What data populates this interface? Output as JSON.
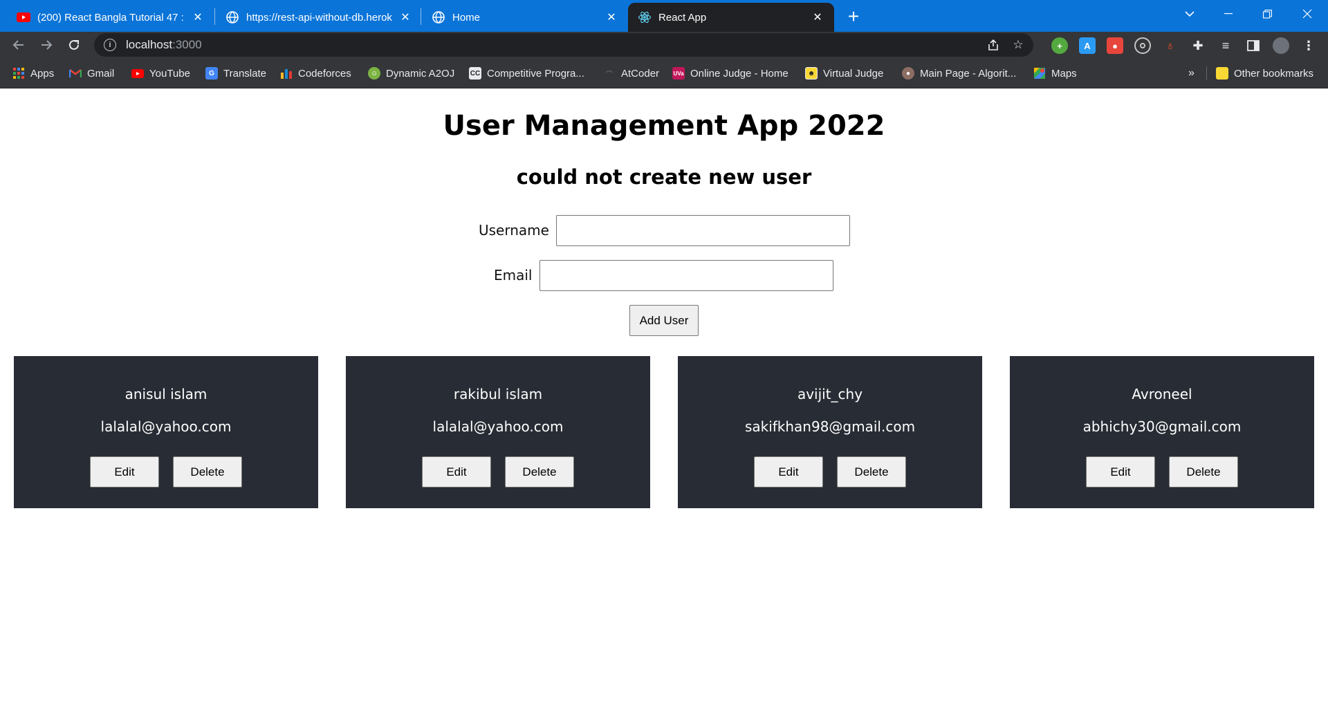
{
  "browser": {
    "tabs": [
      {
        "title": "(200) React Bangla Tutorial 47 : h",
        "favicon": "youtube-icon"
      },
      {
        "title": "https://rest-api-without-db.herok",
        "favicon": "globe-icon"
      },
      {
        "title": "Home",
        "favicon": "globe-icon"
      },
      {
        "title": "React App",
        "favicon": "react-icon",
        "active": true
      }
    ],
    "new_tab": "+",
    "url_host": "localhost",
    "url_port": ":3000",
    "bookmarks": [
      {
        "label": "Apps",
        "icon": "apps-grid-icon"
      },
      {
        "label": "Gmail",
        "icon": "gmail-icon"
      },
      {
        "label": "YouTube",
        "icon": "youtube-icon"
      },
      {
        "label": "Translate",
        "icon": "translate-icon"
      },
      {
        "label": "Codeforces",
        "icon": "codeforces-icon"
      },
      {
        "label": "Dynamic A2OJ",
        "icon": "a2oj-icon"
      },
      {
        "label": "Competitive Progra...",
        "icon": "cc-icon"
      },
      {
        "label": "AtCoder",
        "icon": "atcoder-icon"
      },
      {
        "label": "Online Judge - Home",
        "icon": "uva-icon"
      },
      {
        "label": "Virtual Judge",
        "icon": "vjudge-icon"
      },
      {
        "label": "Main Page - Algorit...",
        "icon": "algorithmist-icon"
      },
      {
        "label": "Maps",
        "icon": "maps-icon"
      }
    ],
    "overflow": "»",
    "other_bookmarks": "Other bookmarks",
    "accent_color": "#0b74d8"
  },
  "app": {
    "title": "User Management App 2022",
    "status": "could not create new user",
    "form": {
      "username_label": "Username",
      "username_value": "",
      "email_label": "Email",
      "email_value": "",
      "submit_label": "Add User"
    },
    "users": [
      {
        "name": "anisul islam",
        "email": "lalalal@yahoo.com"
      },
      {
        "name": "rakibul islam",
        "email": "lalalal@yahoo.com"
      },
      {
        "name": "avijit_chy",
        "email": "sakifkhan98@gmail.com"
      },
      {
        "name": "Avroneel",
        "email": "abhichy30@gmail.com"
      }
    ],
    "edit_label": "Edit",
    "delete_label": "Delete",
    "card_color": "#282c34"
  }
}
